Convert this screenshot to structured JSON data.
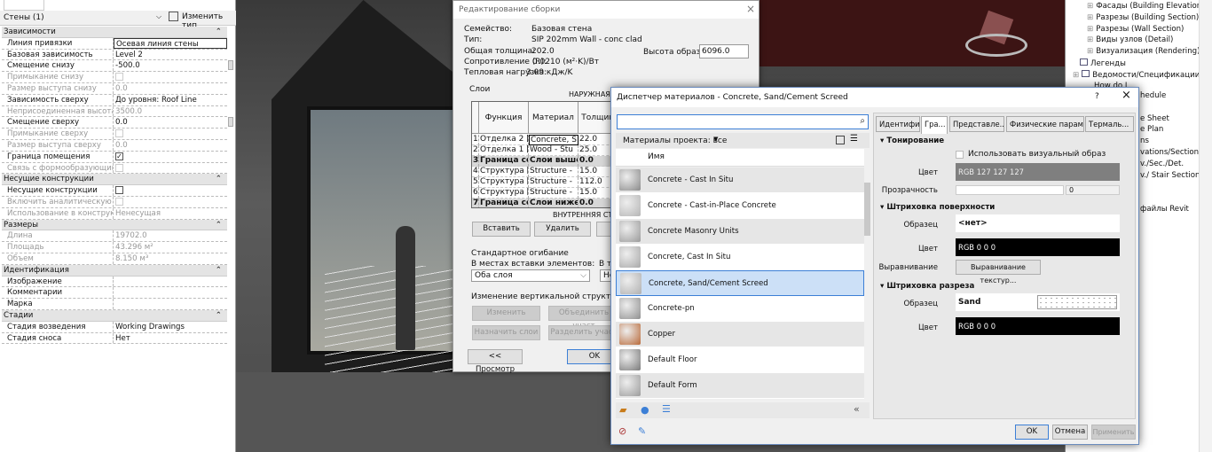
{
  "properties": {
    "type_selector": "Стены (1)",
    "edit_type": "Изменить тип",
    "rows": [
      {
        "kind": "section",
        "label": "Зависимости"
      },
      {
        "label": "Линия привязки",
        "value": "Осевая линия стены"
      },
      {
        "label": "Базовая зависимость",
        "value": "Level 2"
      },
      {
        "label": "Смещение снизу",
        "value": "-500.0"
      },
      {
        "label": "Примыкание снизу",
        "check": false,
        "disabled": true
      },
      {
        "label": "Размер выступа снизу",
        "value": "0.0",
        "disabled": true
      },
      {
        "label": "Зависимость сверху",
        "value": "До уровня: Roof Line"
      },
      {
        "label": "Неприсоединенная высота",
        "value": "3500.0",
        "disabled": true
      },
      {
        "label": "Смещение сверху",
        "value": "0.0"
      },
      {
        "label": "Примыкание сверху",
        "check": false,
        "disabled": true
      },
      {
        "label": "Размер выступа сверху",
        "value": "0.0",
        "disabled": true
      },
      {
        "label": "Граница помещения",
        "check": true
      },
      {
        "label": "Связь с формообразующим ...",
        "check": false,
        "disabled": true
      },
      {
        "kind": "section",
        "label": "Несущие конструкции"
      },
      {
        "label": "Несущие конструкции",
        "check": false
      },
      {
        "label": "Включить аналитическую м...",
        "check": false,
        "disabled": true
      },
      {
        "label": "Использование в конструкции",
        "value": "Ненесущая",
        "disabled": true
      },
      {
        "kind": "section",
        "label": "Размеры"
      },
      {
        "label": "Длина",
        "value": "19702.0",
        "disabled": true
      },
      {
        "label": "Площадь",
        "value": "43.296 м²",
        "disabled": true
      },
      {
        "label": "Объем",
        "value": "8.150 м³",
        "disabled": true
      },
      {
        "kind": "section",
        "label": "Идентификация"
      },
      {
        "label": "Изображение",
        "value": ""
      },
      {
        "label": "Комментарии",
        "value": ""
      },
      {
        "label": "Марка",
        "value": ""
      },
      {
        "kind": "section",
        "label": "Стадии"
      },
      {
        "label": "Стадия возведения",
        "value": "Working Drawings"
      },
      {
        "label": "Стадия сноса",
        "value": "Нет"
      }
    ]
  },
  "browser": {
    "items": [
      {
        "text": "Фасады (Building Elevation)",
        "indent": 2,
        "expander": true
      },
      {
        "text": "Разрезы (Building Section)",
        "indent": 2,
        "expander": true
      },
      {
        "text": "Разрезы (Wall Section)",
        "indent": 2,
        "expander": true
      },
      {
        "text": "Виды узлов (Detail)",
        "indent": 2,
        "expander": true
      },
      {
        "text": "Визуализация (Rendering)",
        "indent": 2,
        "expander": true
      },
      {
        "text": "Легенды",
        "indent": 1,
        "icon": true
      },
      {
        "text": "Ведомости/Спецификации",
        "indent": 0,
        "icon": true,
        "expander": true
      },
      {
        "text": "How do I",
        "indent": 3
      }
    ],
    "fragments": [
      "hedule",
      "",
      "e Sheet",
      "e Plan",
      "ns",
      "vations/Sections",
      "v./Sec./Det.",
      "v./ Stair Sections",
      "",
      "",
      "файлы Revit"
    ]
  },
  "assembly": {
    "title": "Редактирование сборки",
    "info": [
      {
        "label": "Семейство:",
        "value": "Базовая стена"
      },
      {
        "label": "Тип:",
        "value": "SIP 202mm Wall - conc clad"
      },
      {
        "label": "Общая толщина:",
        "value": "202.0"
      },
      {
        "label": "Сопротивление (R):",
        "value": "0.0210 (м²·K)/Вт"
      },
      {
        "label": "Тепловая нагрузка:",
        "value": "3.09 кДж/K"
      }
    ],
    "sample_height_label": "Высота образца:",
    "sample_height": "6096.0",
    "layers_group": "Слои",
    "exterior": "НАРУЖНАЯ СТОРОНА",
    "interior": "ВНУТРЕННЯЯ СТОРОНА",
    "columns": [
      "",
      "Функция",
      "Материал",
      "Толщина"
    ],
    "layers": [
      [
        "1",
        "Отделка 2 [5]",
        "Concrete, S",
        "22.0"
      ],
      [
        "2",
        "Отделка 1 [4]",
        "Wood - Stu",
        "25.0"
      ],
      [
        "3",
        "Граница сер",
        "Слои выше",
        "0.0"
      ],
      [
        "4",
        "Структура [1]",
        "Structure -",
        "15.0"
      ],
      [
        "5",
        "Структура [1]",
        "Structure -",
        "112.0"
      ],
      [
        "6",
        "Структура [1]",
        "Structure -",
        "15.0"
      ],
      [
        "7",
        "Граница сер",
        "Слои ниже о",
        "0.0"
      ]
    ],
    "insert": "Вставить",
    "delete": "Удалить",
    "wrap_group": "Стандартное огибание",
    "wrap_inserts_label": "В местах вставки элементов:",
    "wrap_inserts": "Оба слоя",
    "wrap_ends_label": "В т",
    "wrap_ends": "Нет",
    "vert_group": "Изменение вертикальной структуры (только",
    "modify": "Изменить",
    "merge": "Объединить участ",
    "assign": "Назначить слои",
    "split": "Разделить участ",
    "preview": "<< Просмотр",
    "ok": "OK"
  },
  "materials": {
    "title": "Диспетчер материалов - Concrete, Sand/Cement Screed",
    "search_value": "",
    "filter": "Материалы проекта: все",
    "name_header": "Имя",
    "list": [
      {
        "name": "Concrete - Cast In Situ",
        "swatch": "#8a8a8a"
      },
      {
        "name": "Concrete - Cast-in-Place Concrete",
        "swatch": "#b5b5b5"
      },
      {
        "name": "Concrete Masonry Units",
        "swatch": "#9a9a9a"
      },
      {
        "name": "Concrete, Cast In Situ",
        "swatch": "#a8a8a8"
      },
      {
        "name": "Concrete, Sand/Cement Screed",
        "swatch": "#b0b0b0",
        "selected": true
      },
      {
        "name": "Concrete-pn",
        "swatch": "#8f8f8f"
      },
      {
        "name": "Copper",
        "swatch": "#b86a3a"
      },
      {
        "name": "Default Floor",
        "swatch": "#7a7a7a"
      },
      {
        "name": "Default Form",
        "swatch": "#9c9c9c"
      }
    ],
    "tabs": [
      "Идентифик...",
      "Гра...",
      "Представле...",
      "Физические параме...",
      "Термаль..."
    ],
    "active_tab": 1,
    "shading": {
      "header": "Тонирование",
      "use_render": "Использовать визуальный образ",
      "color_label": "Цвет",
      "color": "RGB 127 127 127",
      "transparency_label": "Прозрачность",
      "transparency": "0"
    },
    "surface": {
      "header": "Штриховка поверхности",
      "pattern_label": "Образец",
      "pattern": "<нет>",
      "color_label": "Цвет",
      "color": "RGB 0 0 0",
      "align_label": "Выравнивание",
      "align_button": "Выравнивание текстур..."
    },
    "cut": {
      "header": "Штриховка разреза",
      "pattern_label": "Образец",
      "pattern": "Sand",
      "color_label": "Цвет",
      "color": "RGB 0 0 0"
    },
    "ok": "OK",
    "cancel": "Отмена",
    "apply": "Применить",
    "help": "?"
  },
  "colors": {
    "selection": "#cce0f7",
    "accent": "#3c7fd6",
    "shading_color": "#7f7f7f"
  }
}
